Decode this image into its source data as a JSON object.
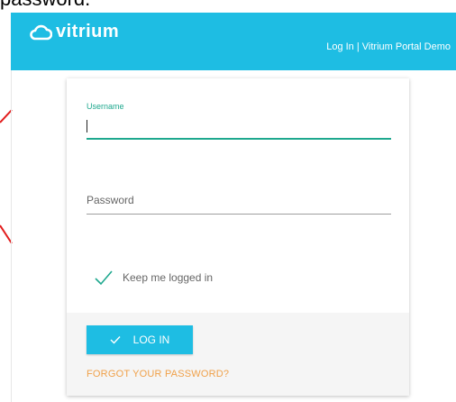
{
  "caption": {
    "text": "password."
  },
  "header": {
    "brand": "vitrium",
    "title": "Log In | Vitrium Portal Demo",
    "accent_color": "#1ebde3"
  },
  "login_form": {
    "username_label": "Username",
    "username_value": "",
    "password_placeholder": "Password",
    "keep_logged_in": {
      "label": "Keep me logged in",
      "checked": true
    },
    "login_button": "LOG IN",
    "forgot_link": "FORGOT YOUR PASSWORD?"
  },
  "icons": {
    "logo": "cloud-icon",
    "check": "check-icon"
  }
}
